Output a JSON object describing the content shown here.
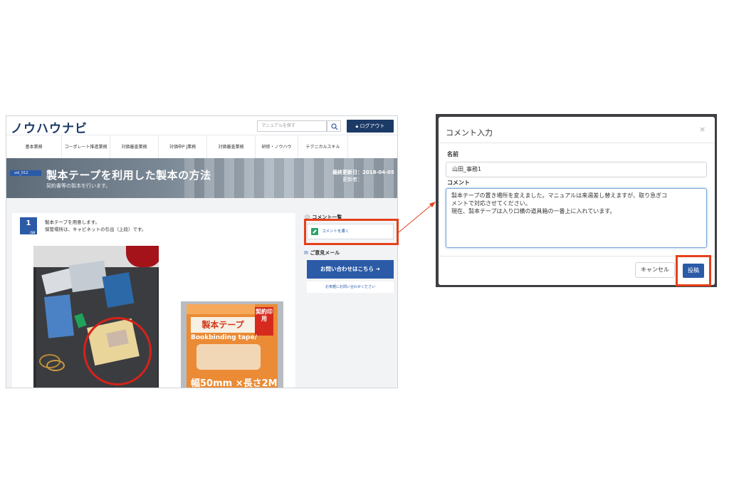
{
  "left_screenshot": {
    "logo": "ノウハウナビ",
    "search_placeholder": "マニュアルを探す",
    "logout_label": "ログアウト",
    "nav_items": [
      "基本業務",
      "コーポレート推進業務",
      "対価審査業務",
      "対価申P J業務",
      "対価審査業務",
      "研修・ノウハウ",
      "テクニカルスキル"
    ],
    "vol_badge": "vol_012",
    "article_title": "製本テープを利用した製本の方法",
    "article_subtitle": "契約書等の製本を行います。",
    "last_updated": "最終更新日：2018-04-05",
    "updater": "更新者：",
    "step": {
      "number": "1",
      "total": "/10",
      "line1": "製本テープを用意します。",
      "line2": "保管場所は、キャビネットの引出（上段）です。"
    },
    "photo_tape": {
      "title": "製本テープ",
      "tag": "契約印用",
      "english": "Bookbinding tape/",
      "size": "幅50mm ×長さ2M"
    },
    "sidebar": {
      "comment_list_heading": "コメント一覧",
      "write_comment": "コメントを書く",
      "feedback_heading": "ご意見メール",
      "inquiry_button": "お問い合わせはこちら ➜",
      "inquiry_link": "お気軽にお問い合わせください"
    }
  },
  "modal": {
    "title": "コメント入力",
    "close": "×",
    "name_label": "名前",
    "name_value": "山田_事務1",
    "comment_label": "コメント",
    "comment_lines": [
      "製本テープの置き場所を変えました。マニュアルは来週差し替えますが、取り急ぎコ",
      "メントで対応させてください。",
      "現在、製本テープは入り口横の道具箱の一番上に入れています。"
    ],
    "cancel_label": "キャンセル",
    "post_label": "投稿"
  },
  "colors": {
    "brand_navy": "#1b3a66",
    "accent_blue": "#2b5aa7",
    "highlight_orange": "#e5401a"
  },
  "icons": [
    "search-icon",
    "lock-icon",
    "pencil-icon",
    "mail-icon",
    "comment-icon",
    "close-icon"
  ]
}
